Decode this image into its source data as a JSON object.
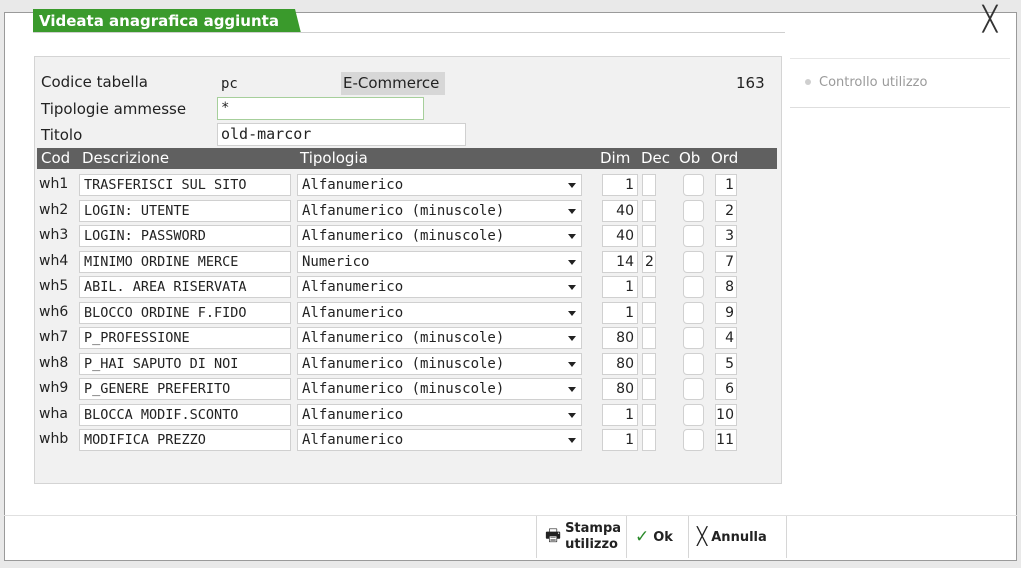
{
  "window": {
    "title": "Videata anagrafica aggiunta",
    "close_glyph": "╳"
  },
  "form": {
    "codice_label": "Codice tabella",
    "codice_value": "pc",
    "codice_desc": "E-Commerce",
    "codice_num": "163",
    "tipologie_label": "Tipologie ammesse",
    "tipologie_value": "*",
    "titolo_label": "Titolo",
    "titolo_value": "old-marcor"
  },
  "table": {
    "headers": {
      "cod": "Cod",
      "descrizione": "Descrizione",
      "tipologia": "Tipologia",
      "dim": "Dim",
      "dec": "Dec",
      "ob": "Ob",
      "ord": "Ord"
    },
    "rows": [
      {
        "cod": "wh1",
        "desc": "TRASFERISCI SUL SITO",
        "tipo": "Alfanumerico",
        "dim": "1",
        "dec": "",
        "ord": "1"
      },
      {
        "cod": "wh2",
        "desc": "LOGIN: UTENTE",
        "tipo": "Alfanumerico (minuscole)",
        "dim": "40",
        "dec": "",
        "ord": "2"
      },
      {
        "cod": "wh3",
        "desc": "LOGIN: PASSWORD",
        "tipo": "Alfanumerico (minuscole)",
        "dim": "40",
        "dec": "",
        "ord": "3"
      },
      {
        "cod": "wh4",
        "desc": "MINIMO ORDINE MERCE",
        "tipo": "Numerico",
        "dim": "14",
        "dec": "2",
        "ord": "7"
      },
      {
        "cod": "wh5",
        "desc": "ABIL. AREA RISERVATA",
        "tipo": "Alfanumerico",
        "dim": "1",
        "dec": "",
        "ord": "8"
      },
      {
        "cod": "wh6",
        "desc": "BLOCCO ORDINE F.FIDO",
        "tipo": "Alfanumerico",
        "dim": "1",
        "dec": "",
        "ord": "9"
      },
      {
        "cod": "wh7",
        "desc": "P_PROFESSIONE",
        "tipo": "Alfanumerico (minuscole)",
        "dim": "80",
        "dec": "",
        "ord": "4"
      },
      {
        "cod": "wh8",
        "desc": "P_HAI SAPUTO DI NOI",
        "tipo": "Alfanumerico (minuscole)",
        "dim": "80",
        "dec": "",
        "ord": "5"
      },
      {
        "cod": "wh9",
        "desc": "P_GENERE PREFERITO",
        "tipo": "Alfanumerico (minuscole)",
        "dim": "80",
        "dec": "",
        "ord": "6"
      },
      {
        "cod": "wha",
        "desc": "BLOCCA MODIF.SCONTO",
        "tipo": "Alfanumerico",
        "dim": "1",
        "dec": "",
        "ord": "10"
      },
      {
        "cod": "whb",
        "desc": "MODIFICA PREZZO",
        "tipo": "Alfanumerico",
        "dim": "1",
        "dec": "",
        "ord": "11"
      }
    ]
  },
  "sidebar": {
    "controllo_label": "Controllo utilizzo"
  },
  "buttons": {
    "stampa_line1": "Stampa",
    "stampa_line2": "utilizzo",
    "ok": "Ok",
    "annulla": "Annulla"
  },
  "colors": {
    "title_green": "#3a9a2c",
    "header_gray": "#606060"
  }
}
